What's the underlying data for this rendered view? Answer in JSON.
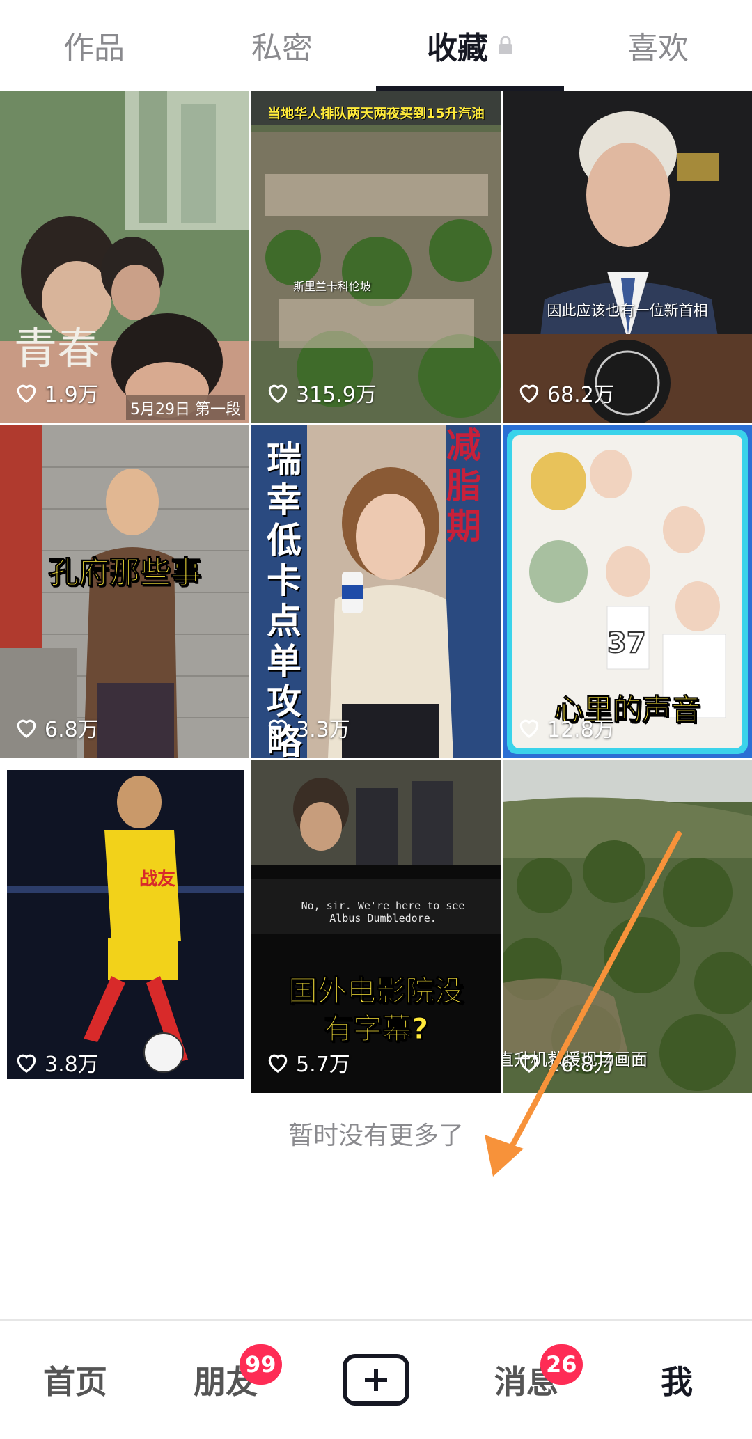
{
  "tabs": [
    {
      "label": "作品",
      "active": false
    },
    {
      "label": "私密",
      "active": false
    },
    {
      "label": "收藏",
      "active": true,
      "icon": "lock-icon"
    },
    {
      "label": "喜欢",
      "active": false
    }
  ],
  "videos": [
    {
      "likes": "1.9万",
      "caption": "青春",
      "sub": "5月29日 第一段"
    },
    {
      "likes": "315.9万",
      "caption": "当地华人排队两天两夜买到15升汽油",
      "sub": "斯里兰卡科伦坡"
    },
    {
      "likes": "68.2万",
      "caption": "因此应该也有一位新首相",
      "sub": ""
    },
    {
      "likes": "6.8万",
      "caption": "孔府那些事",
      "sub": ""
    },
    {
      "likes": "3.3万",
      "caption": "瑞幸低卡点单攻略",
      "sub": "减脂期"
    },
    {
      "likes": "12.8万",
      "caption": "心里的声音",
      "sub": "37"
    },
    {
      "likes": "3.8万",
      "caption": "战友",
      "sub": ""
    },
    {
      "likes": "5.7万",
      "caption": "国外电影院没有字幕?",
      "sub": "No, sir. We're here to see Albus Dumbledore."
    },
    {
      "likes": "26.8万",
      "caption": "直升机救援现场画面",
      "sub": ""
    }
  ],
  "no_more_text": "暂时没有更多了",
  "nav": [
    {
      "label": "首页",
      "badge": ""
    },
    {
      "label": "朋友",
      "badge": "99"
    },
    {
      "label": "",
      "icon": "plus-icon"
    },
    {
      "label": "消息",
      "badge": "26"
    },
    {
      "label": "我",
      "badge": ""
    }
  ],
  "colors": {
    "accent": "#fe2c55",
    "arrow": "#f7923a",
    "text_dark": "#161823",
    "text_muted": "#8a8a8e"
  }
}
